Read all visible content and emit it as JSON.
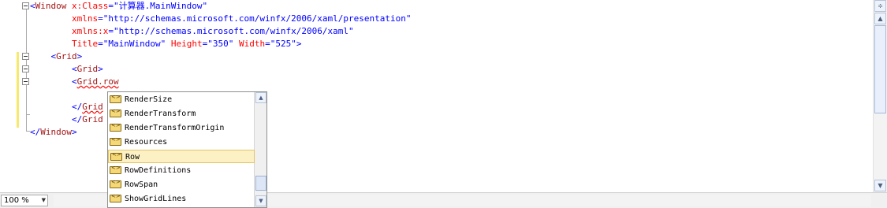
{
  "editor": {
    "lines": [
      [
        {
          "t": "<",
          "c": "b"
        },
        {
          "t": "Window",
          "c": "e"
        },
        {
          "t": " x:Class",
          "c": "a"
        },
        {
          "t": "=",
          "c": "b"
        },
        {
          "t": "\"计算器.MainWindow\"",
          "c": "b"
        }
      ],
      [
        {
          "t": "        "
        },
        {
          "t": "xmlns",
          "c": "a"
        },
        {
          "t": "=",
          "c": "b"
        },
        {
          "t": "\"http://schemas.microsoft.com/winfx/2006/xaml/presentation\"",
          "c": "b"
        }
      ],
      [
        {
          "t": "        "
        },
        {
          "t": "xmlns:x",
          "c": "a"
        },
        {
          "t": "=",
          "c": "b"
        },
        {
          "t": "\"http://schemas.microsoft.com/winfx/2006/xaml\"",
          "c": "b"
        }
      ],
      [
        {
          "t": "        "
        },
        {
          "t": "Title",
          "c": "a"
        },
        {
          "t": "=",
          "c": "b"
        },
        {
          "t": "\"MainWindow\"",
          "c": "b"
        },
        {
          "t": " Height",
          "c": "a"
        },
        {
          "t": "=",
          "c": "b"
        },
        {
          "t": "\"350\"",
          "c": "b"
        },
        {
          "t": " Width",
          "c": "a"
        },
        {
          "t": "=",
          "c": "b"
        },
        {
          "t": "\"525\"",
          "c": "b"
        },
        {
          "t": ">",
          "c": "b"
        }
      ],
      [
        {
          "t": "    "
        },
        {
          "t": "<",
          "c": "b"
        },
        {
          "t": "Grid",
          "c": "e"
        },
        {
          "t": ">",
          "c": "b"
        }
      ],
      [
        {
          "t": "        "
        },
        {
          "t": "<",
          "c": "b"
        },
        {
          "t": "Grid",
          "c": "e"
        },
        {
          "t": ">",
          "c": "b"
        }
      ],
      [
        {
          "t": "        "
        },
        {
          "t": "<",
          "c": "b"
        },
        {
          "t": "Grid.row",
          "c": "e sq"
        }
      ],
      [
        {
          "t": ""
        }
      ],
      [
        {
          "t": "        "
        },
        {
          "t": "</",
          "c": "b"
        },
        {
          "t": "Grid",
          "c": "e sq"
        }
      ],
      [
        {
          "t": "        "
        },
        {
          "t": "</",
          "c": "b"
        },
        {
          "t": "Grid",
          "c": "e"
        }
      ],
      [
        {
          "t": "</",
          "c": "b"
        },
        {
          "t": "Window",
          "c": "e"
        },
        {
          "t": ">",
          "c": "b"
        }
      ]
    ]
  },
  "completion": {
    "items": [
      "RenderSize",
      "RenderTransform",
      "RenderTransformOrigin",
      "Resources",
      "Row",
      "RowDefinitions",
      "RowSpan",
      "ShowGridLines"
    ],
    "selected_index": 4
  },
  "statusbar": {
    "zoom": "100 %"
  }
}
